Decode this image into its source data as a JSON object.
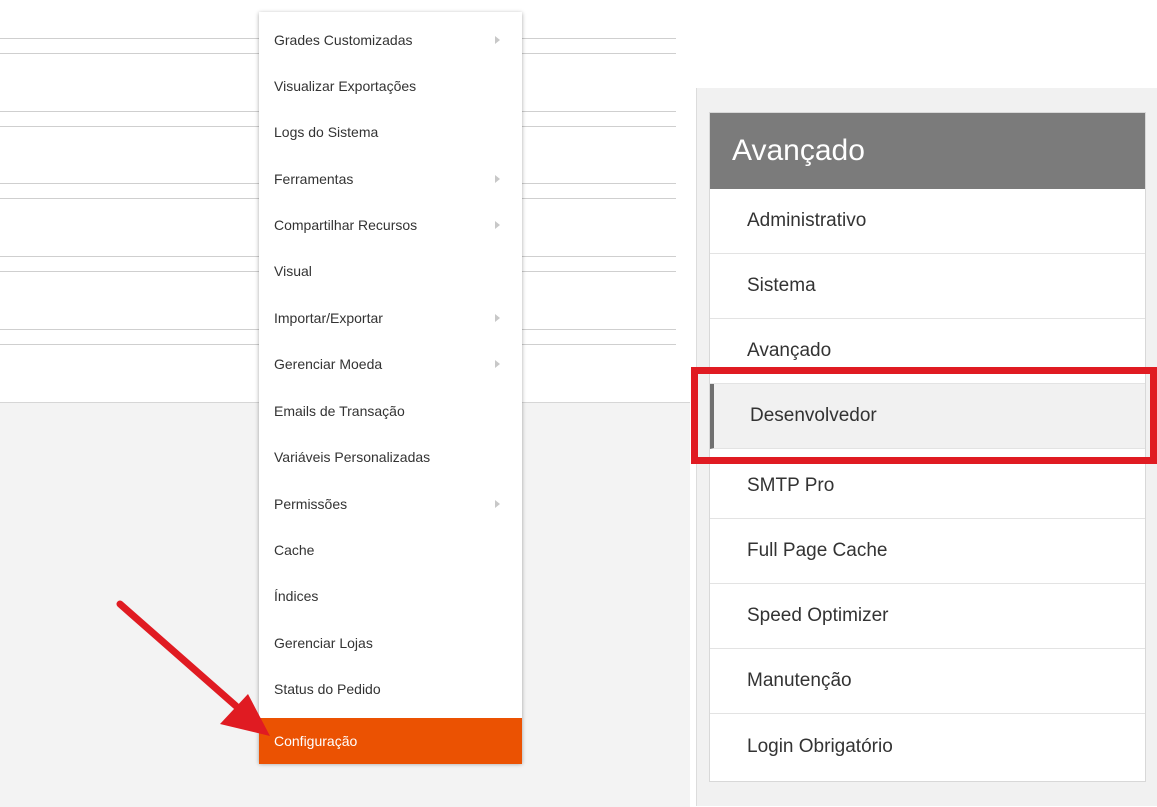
{
  "menu": {
    "items": [
      {
        "label": "Grades Customizadas",
        "submenu": true
      },
      {
        "label": "Visualizar Exportações",
        "submenu": false
      },
      {
        "label": "Logs do Sistema",
        "submenu": false
      },
      {
        "label": "Ferramentas",
        "submenu": true
      },
      {
        "label": "Compartilhar Recursos",
        "submenu": true
      },
      {
        "label": "Visual",
        "submenu": false
      },
      {
        "label": "Importar/Exportar",
        "submenu": true
      },
      {
        "label": "Gerenciar Moeda",
        "submenu": true
      },
      {
        "label": "Emails de Transação",
        "submenu": false
      },
      {
        "label": "Variáveis Personalizadas",
        "submenu": false
      },
      {
        "label": "Permissões",
        "submenu": true
      },
      {
        "label": "Cache",
        "submenu": false
      },
      {
        "label": "Índices",
        "submenu": false
      },
      {
        "label": "Gerenciar Lojas",
        "submenu": false
      },
      {
        "label": "Status do Pedido",
        "submenu": false
      },
      {
        "label": "Configuração",
        "submenu": false,
        "active": true
      }
    ],
    "accent_color": "#eb5202"
  },
  "config_panel": {
    "title": "Avançado",
    "items": [
      {
        "label": "Administrativo"
      },
      {
        "label": "Sistema"
      },
      {
        "label": "Avançado"
      },
      {
        "label": "Desenvolvedor",
        "selected": true
      },
      {
        "label": "SMTP Pro"
      },
      {
        "label": "Full Page Cache"
      },
      {
        "label": "Speed Optimizer"
      },
      {
        "label": "Manutenção"
      },
      {
        "label": "Login Obrigatório"
      }
    ]
  },
  "annotations": {
    "arrow_color": "#e01b22",
    "highlight_color": "#e01b22"
  }
}
